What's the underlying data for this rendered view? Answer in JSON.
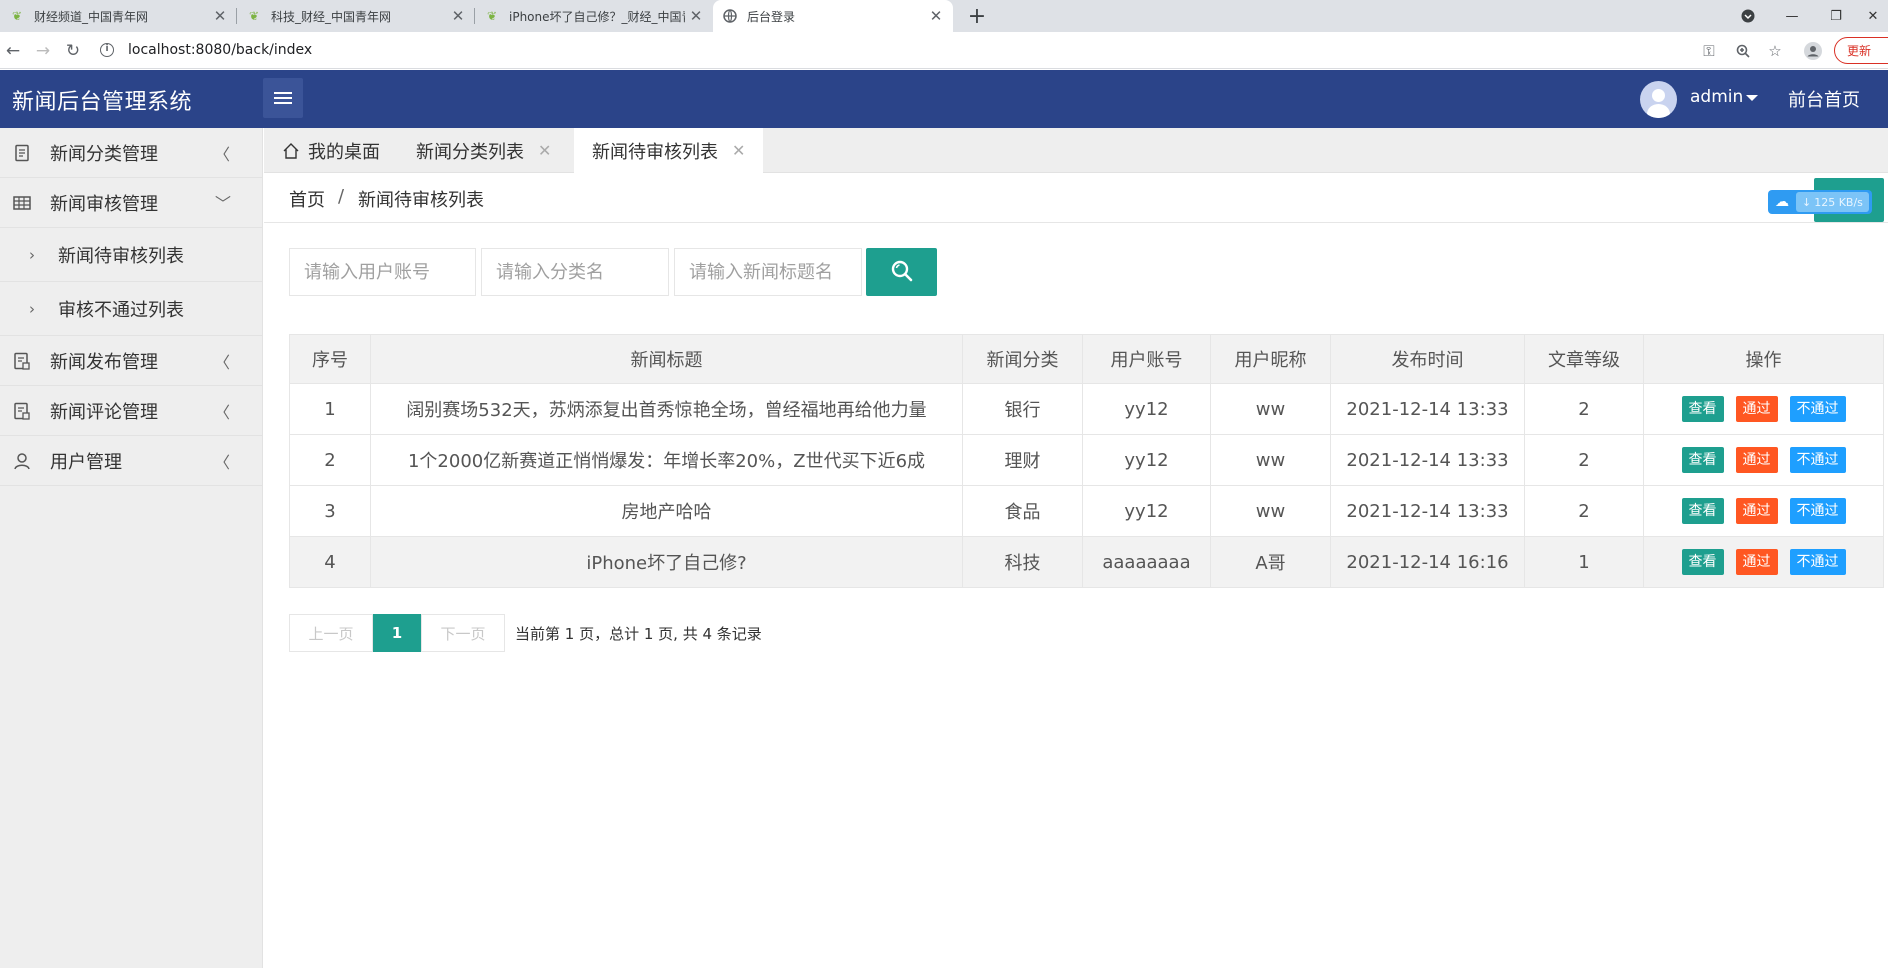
{
  "browser": {
    "tabs": [
      {
        "title": "财经频道_中国青年网",
        "active": false
      },
      {
        "title": "科技_财经_中国青年网",
        "active": false
      },
      {
        "title": "iPhone坏了自己修？_财经_中国青",
        "active": false
      },
      {
        "title": "后台登录",
        "active": true
      }
    ],
    "url": "localhost:8080/back/index",
    "update_label": "更新"
  },
  "header": {
    "logo": "新闻后台管理系统",
    "username": "admin",
    "front_link": "前台首页"
  },
  "sidebar": {
    "items": [
      {
        "label": "新闻分类管理",
        "icon": "document-icon",
        "expanded": false
      },
      {
        "label": "新闻审核管理",
        "icon": "table-icon",
        "expanded": true,
        "children": [
          {
            "label": "新闻待审核列表"
          },
          {
            "label": "审核不通过列表"
          }
        ]
      },
      {
        "label": "新闻发布管理",
        "icon": "publish-icon",
        "expanded": false
      },
      {
        "label": "新闻评论管理",
        "icon": "comment-icon",
        "expanded": false
      },
      {
        "label": "用户管理",
        "icon": "user-icon",
        "expanded": false
      }
    ]
  },
  "page_tabs": [
    {
      "label": "我的桌面",
      "closable": false,
      "active": false
    },
    {
      "label": "新闻分类列表",
      "closable": true,
      "active": false
    },
    {
      "label": "新闻待审核列表",
      "closable": true,
      "active": true
    }
  ],
  "breadcrumb": {
    "home": "首页",
    "separator": "/",
    "current": "新闻待审核列表"
  },
  "net_speed": "125 KB/s",
  "search": {
    "user_placeholder": "请输入用户账号",
    "category_placeholder": "请输入分类名",
    "title_placeholder": "请输入新闻标题名"
  },
  "table": {
    "columns": [
      "序号",
      "新闻标题",
      "新闻分类",
      "用户账号",
      "用户昵称",
      "发布时间",
      "文章等级",
      "操作"
    ],
    "rows": [
      {
        "no": "1",
        "title": "阔别赛场532天，苏炳添复出首秀惊艳全场，曾经福地再给他力量",
        "category": "银行",
        "account": "yy12",
        "nickname": "ww",
        "time": "2021-12-14 13:33",
        "level": "2"
      },
      {
        "no": "2",
        "title": "1个2000亿新赛道正悄悄爆发：年增长率20%，Z世代买下近6成",
        "category": "理财",
        "account": "yy12",
        "nickname": "ww",
        "time": "2021-12-14 13:33",
        "level": "2"
      },
      {
        "no": "3",
        "title": "房地产哈哈",
        "category": "食品",
        "account": "yy12",
        "nickname": "ww",
        "time": "2021-12-14 13:33",
        "level": "2"
      },
      {
        "no": "4",
        "title": "iPhone坏了自己修?",
        "category": "科技",
        "account": "aaaaaaaa",
        "nickname": "A哥",
        "time": "2021-12-14 16:16",
        "level": "1"
      }
    ],
    "actions": {
      "view": "查看",
      "pass": "通过",
      "reject": "不通过"
    }
  },
  "pager": {
    "prev": "上一页",
    "current": "1",
    "next": "下一页",
    "info": "当前第 1 页，总计 1 页, 共 4 条记录"
  },
  "colors": {
    "header_bg": "#2b4489",
    "accent": "#1e9f8f",
    "pass": "#ff5722",
    "reject": "#1e9fff"
  }
}
